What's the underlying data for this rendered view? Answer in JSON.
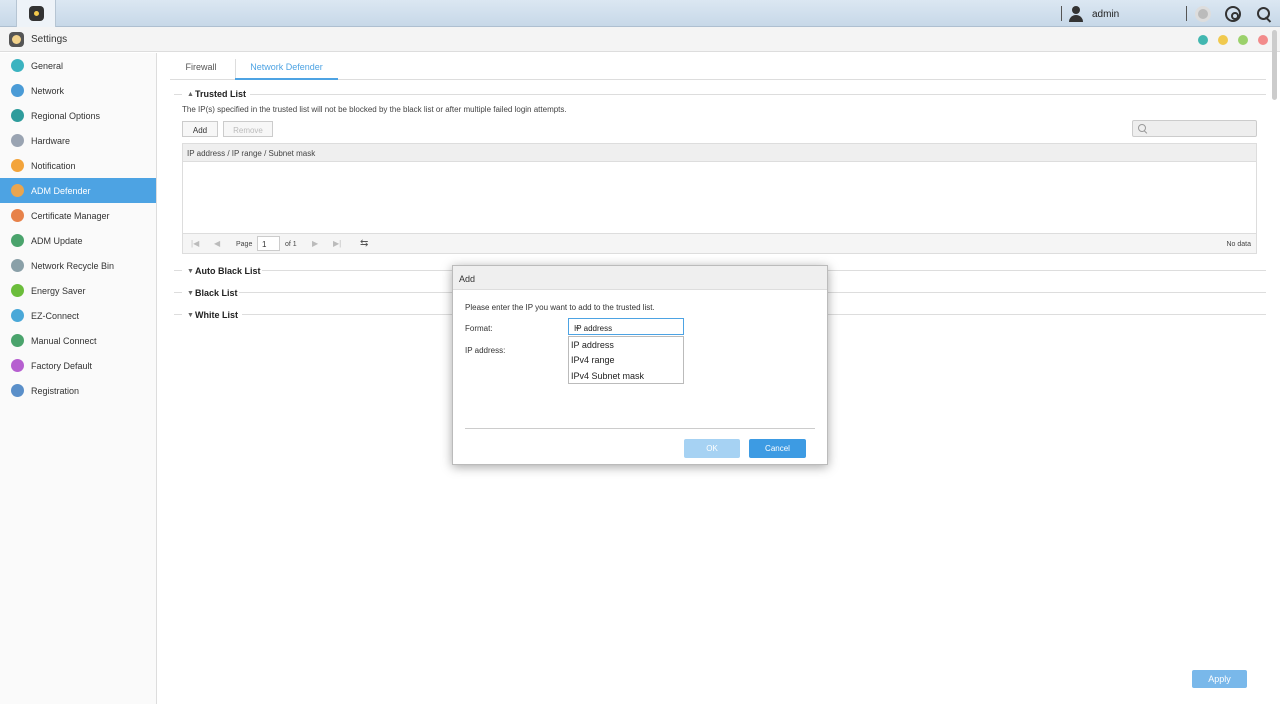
{
  "topbar": {
    "username": "admin"
  },
  "window": {
    "title": "Settings",
    "buttons": [
      "#42b7b0",
      "#f0c94e",
      "#9bd16b",
      "#f28b8b"
    ]
  },
  "sidebar": {
    "items": [
      {
        "label": "General",
        "icon": "general-icon",
        "color": "#3bb3c0"
      },
      {
        "label": "Network",
        "icon": "globe-icon",
        "color": "#4a9bd6"
      },
      {
        "label": "Regional Options",
        "icon": "regional-icon",
        "color": "#2e9c9c"
      },
      {
        "label": "Hardware",
        "icon": "hardware-icon",
        "color": "#9aa4b2"
      },
      {
        "label": "Notification",
        "icon": "notification-icon",
        "color": "#f3a43b"
      },
      {
        "label": "ADM Defender",
        "icon": "defender-icon",
        "color": "#e9a54f",
        "active": true
      },
      {
        "label": "Certificate Manager",
        "icon": "certificate-icon",
        "color": "#e7824a"
      },
      {
        "label": "ADM Update",
        "icon": "update-icon",
        "color": "#4aa36c"
      },
      {
        "label": "Network Recycle Bin",
        "icon": "recycle-bin-icon",
        "color": "#8aa0a8"
      },
      {
        "label": "Energy Saver",
        "icon": "energy-icon",
        "color": "#6bbd3b"
      },
      {
        "label": "EZ-Connect",
        "icon": "ez-connect-icon",
        "color": "#4aa8d8"
      },
      {
        "label": "Manual Connect",
        "icon": "manual-connect-icon",
        "color": "#4aa36c"
      },
      {
        "label": "Factory Default",
        "icon": "factory-default-icon",
        "color": "#b65fd0"
      },
      {
        "label": "Registration",
        "icon": "registration-icon",
        "color": "#5a8fc9"
      }
    ]
  },
  "tabs": [
    {
      "label": "Firewall"
    },
    {
      "label": "Network Defender",
      "active": true
    }
  ],
  "trusted": {
    "title": "Trusted List",
    "description": "The IP(s) specified in the trusted list will not be blocked by the black list or after multiple failed login attempts.",
    "add_label": "Add",
    "remove_label": "Remove",
    "column": "IP address / IP range / Subnet mask",
    "page_label": "Page",
    "page_value": "1",
    "page_of": "of 1",
    "no_data": "No data"
  },
  "sections": {
    "auto_black": "Auto Black List",
    "black": "Black List",
    "white": "White List"
  },
  "apply_label": "Apply",
  "dialog": {
    "title": "Add",
    "instruction": "Please enter the IP you want to add to the trusted list.",
    "format_label": "Format:",
    "format_value": "IP address",
    "ip_label": "IP address:",
    "options": [
      "IP address",
      "IPv4 range",
      "IPv4 Subnet mask"
    ],
    "ok_label": "OK",
    "cancel_label": "Cancel"
  }
}
